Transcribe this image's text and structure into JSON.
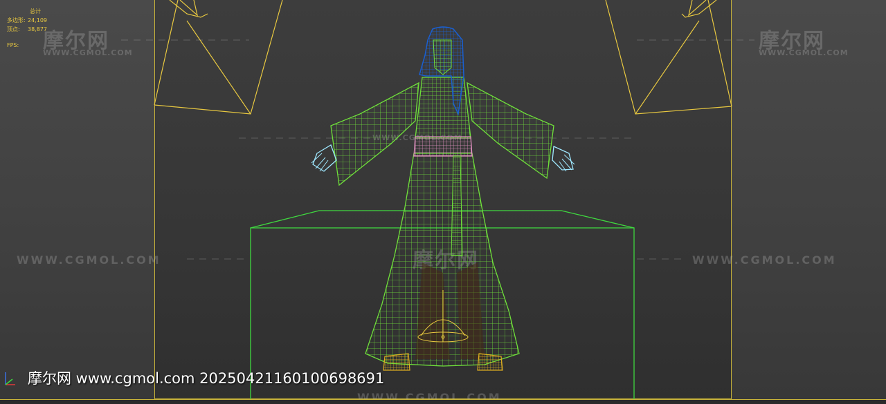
{
  "viewport": {
    "stats": {
      "header": "总计",
      "polys_label": "多边形:",
      "polys_value": "24,109",
      "verts_label": "顶点:",
      "verts_value": "38,877",
      "fps_label": "FPS:"
    }
  },
  "watermark": {
    "logo": "摩尔网",
    "domain_small": "WWW.CGMOL.COM",
    "domain_line": "WWW.CGMOL.COM"
  },
  "caption": "摩尔网 www.cgmol.com 20250421160100698691",
  "colors": {
    "frame": "#c9b43a",
    "stats_text": "#e8c840",
    "robe_wire": "#6fe03a",
    "hair_wire": "#1a5fd0",
    "hands_wire": "#9fe8ff",
    "belt_wire": "#e090c0",
    "boots_wire": "#e0b020",
    "camera_wire": "#e8c840",
    "box_wire": "#3fd83f"
  },
  "icons": [
    "axis-gizmo-icon"
  ]
}
